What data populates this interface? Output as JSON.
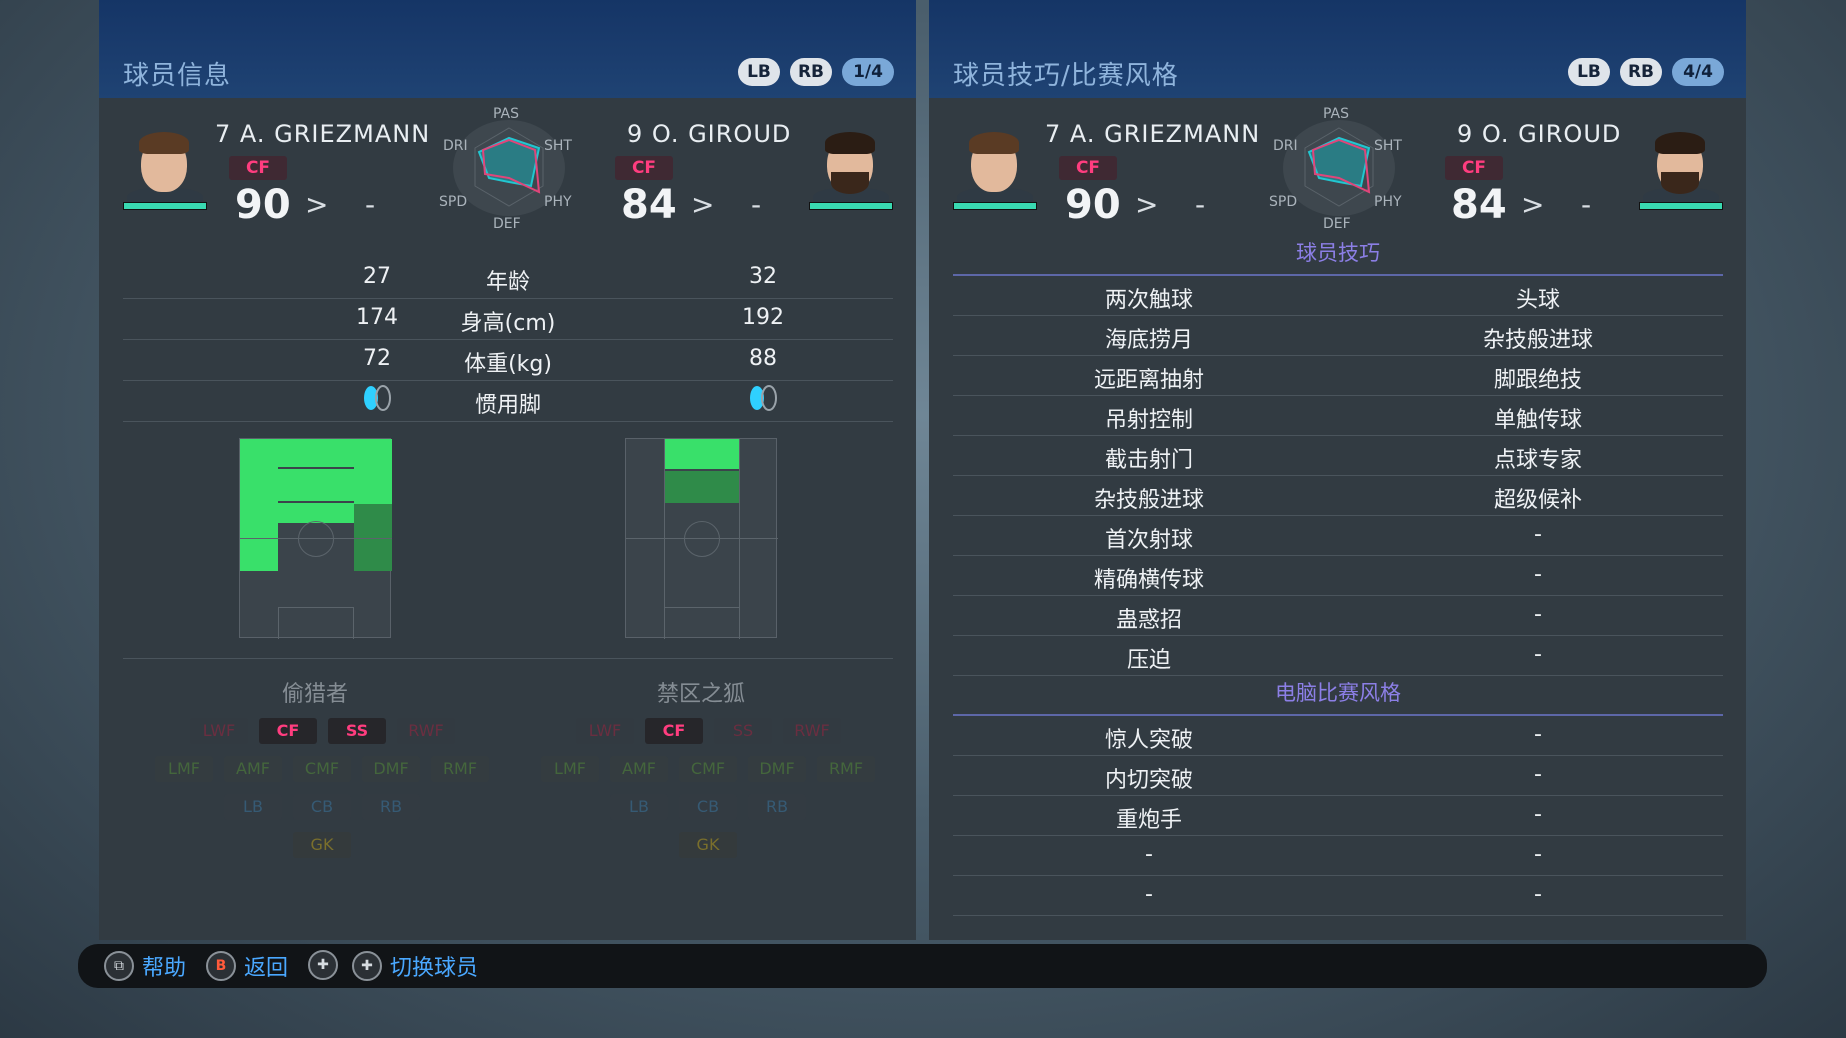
{
  "left": {
    "title": "球员信息",
    "badges": [
      "LB",
      "RB",
      "1/4"
    ],
    "player1": {
      "name": "7 A. GRIEZMANN",
      "pos": "CF",
      "rating": "90",
      "arrow": ">",
      "dash": "-"
    },
    "player2": {
      "name": "9 O. GIROUD",
      "pos": "CF",
      "rating": "84",
      "arrow": ">",
      "dash": "-"
    },
    "radar_labels": {
      "pas": "PAS",
      "sht": "SHT",
      "phy": "PHY",
      "def": "DEF",
      "spd": "SPD",
      "dri": "DRI"
    },
    "stats": [
      {
        "label": "年龄",
        "p1": "27",
        "p2": "32"
      },
      {
        "label": "身高(cm)",
        "p1": "174",
        "p2": "192"
      },
      {
        "label": "体重(kg)",
        "p1": "72",
        "p2": "88"
      },
      {
        "label": "惯用脚",
        "p1": "",
        "p2": ""
      }
    ],
    "style1": "偷猎者",
    "style2": "禁区之狐",
    "positions": {
      "att": [
        "LWF",
        "CF",
        "SS",
        "RWF"
      ],
      "mid": [
        "LMF",
        "AMF",
        "CMF",
        "DMF",
        "RMF"
      ],
      "def": [
        "LB",
        "CB",
        "RB"
      ],
      "gk": [
        "GK"
      ]
    }
  },
  "right": {
    "title": "球员技巧/比赛风格",
    "badges": [
      "LB",
      "RB",
      "4/4"
    ],
    "player1": {
      "name": "7 A. GRIEZMANN",
      "pos": "CF",
      "rating": "90",
      "arrow": ">",
      "dash": "-"
    },
    "player2": {
      "name": "9 O. GIROUD",
      "pos": "CF",
      "rating": "84",
      "arrow": ">",
      "dash": "-"
    },
    "skills_header": "球员技巧",
    "skills": [
      [
        "两次触球",
        "头球"
      ],
      [
        "海底捞月",
        "杂技般进球"
      ],
      [
        "远距离抽射",
        "脚跟绝技"
      ],
      [
        "吊射控制",
        "单触传球"
      ],
      [
        "截击射门",
        "点球专家"
      ],
      [
        "杂技般进球",
        "超级候补"
      ],
      [
        "首次射球",
        "-"
      ],
      [
        "精确横传球",
        "-"
      ],
      [
        "蛊惑招",
        "-"
      ],
      [
        "压迫",
        "-"
      ]
    ],
    "ai_header": "电脑比赛风格",
    "ai_styles": [
      [
        "惊人突破",
        "-"
      ],
      [
        "内切突破",
        "-"
      ],
      [
        "重炮手",
        "-"
      ],
      [
        "-",
        "-"
      ],
      [
        "-",
        "-"
      ]
    ]
  },
  "bottom": {
    "help_label": "帮助",
    "back_label": "返回",
    "switch_label": "切换球员",
    "b_key": "B"
  },
  "colors": {
    "accent_pink": "#ff3d7f",
    "accent_teal": "#39d9b1",
    "pitch_green": "#39e06a",
    "section_purple": "#8c7fe6",
    "hint_blue": "#4aa8ff"
  }
}
